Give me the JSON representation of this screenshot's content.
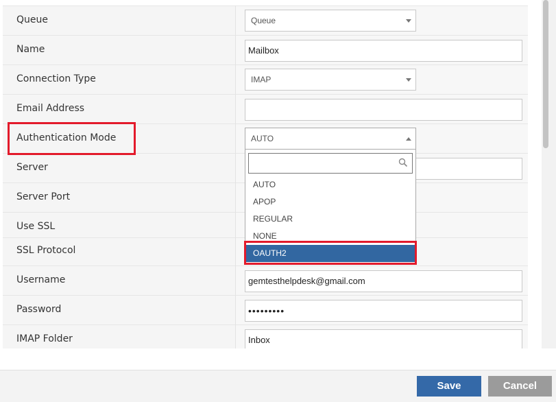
{
  "form": {
    "queue": {
      "label": "Queue",
      "value": "Queue"
    },
    "name": {
      "label": "Name",
      "value": "Mailbox"
    },
    "connection_type": {
      "label": "Connection Type",
      "value": "IMAP"
    },
    "email_address": {
      "label": "Email Address",
      "value": ""
    },
    "authentication_mode": {
      "label": "Authentication Mode",
      "value": "AUTO"
    },
    "server": {
      "label": "Server",
      "value": ""
    },
    "server_port": {
      "label": "Server Port"
    },
    "use_ssl": {
      "label": "Use SSL"
    },
    "ssl_protocol": {
      "label": "SSL Protocol"
    },
    "username": {
      "label": "Username",
      "value": "gemtesthelpdesk@gmail.com"
    },
    "password": {
      "label": "Password",
      "value": "•••••••••"
    },
    "imap_folder": {
      "label": "IMAP Folder",
      "value": "Inbox"
    }
  },
  "auth_dropdown": {
    "search_value": "",
    "options": [
      "AUTO",
      "APOP",
      "REGULAR",
      "NONE",
      "OAUTH2"
    ],
    "highlighted": "OAUTH2"
  },
  "footer": {
    "save_label": "Save",
    "cancel_label": "Cancel"
  },
  "colors": {
    "accent": "#3469a8",
    "highlight_box": "#e31a2b",
    "cancel": "#9b9b9b"
  },
  "icons": {
    "dropdown_search": "search-icon",
    "select_arrow": "caret-down-icon"
  }
}
